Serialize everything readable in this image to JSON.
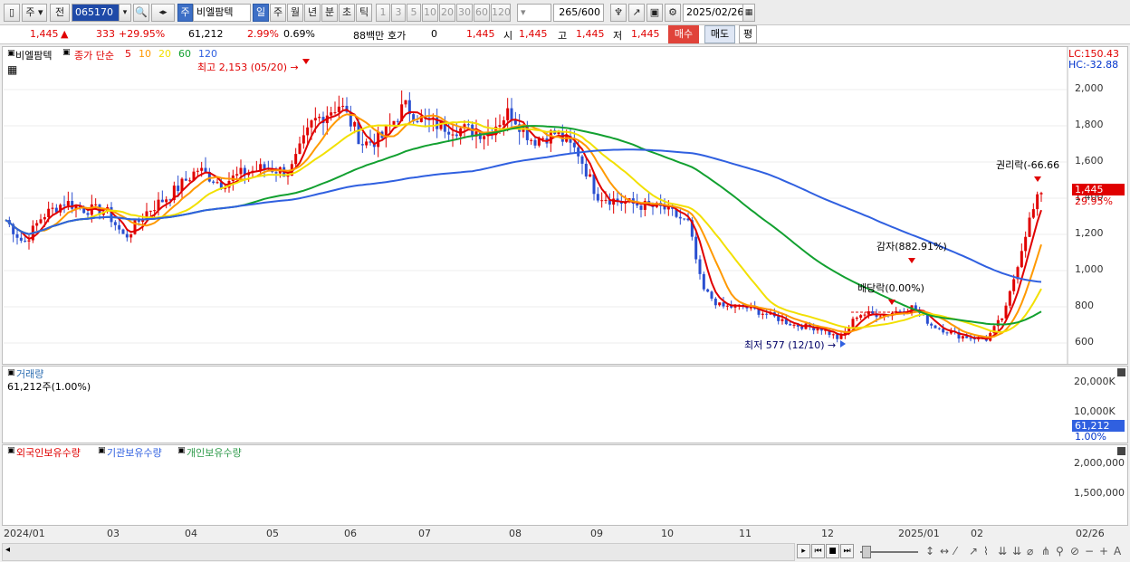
{
  "toolbar": {
    "market": "주",
    "all": "전",
    "code": "065170",
    "stock_name": "비엘팜텍",
    "mode": "주",
    "periods": [
      "일",
      "주",
      "월",
      "년",
      "분",
      "초",
      "틱"
    ],
    "minutes": [
      "1",
      "3",
      "5",
      "10",
      "20",
      "30",
      "60",
      "120"
    ],
    "count": "265",
    "count_total": "/600",
    "date": "2025/02/26"
  },
  "quote": {
    "price": "1,445",
    "change": "333",
    "change_pct": "+29.95%",
    "volume": "61,212",
    "pct1": "2.99%",
    "pct2": "0.69%",
    "amount": "88백만",
    "ask_label": "호가",
    "ask_value": "0",
    "ask_price": "1,445",
    "open_label": "시",
    "open": "1,445",
    "high_label": "고",
    "high": "1,445",
    "low_label": "저",
    "low": "1,445",
    "buy": "매수",
    "sell": "매도",
    "avg": "평"
  },
  "price_panel": {
    "title": "비엘팜텍",
    "legend": "종가 단순",
    "ma": [
      "5",
      "10",
      "20",
      "60",
      "120"
    ],
    "ma_colors": [
      "#e00000",
      "#ff9900",
      "#f2e000",
      "#12a030",
      "#3060e0"
    ],
    "lc": "LC:150.43",
    "hc": "HC:-32.88",
    "yticks": [
      "2,000",
      "1,800",
      "1,600",
      "1,400",
      "1,200",
      "1,000",
      "800",
      "600"
    ],
    "high_note": "최고 2,153 (05/20)",
    "low_note": "최저 577 (12/10)",
    "ann_rights": "권리락(-66.66",
    "ann_reduce": "감자(882.91%)",
    "ann_div": "배당락(0.00%)",
    "last_price": "1,445",
    "last_pct": "29.95%"
  },
  "volume_panel": {
    "title": "거래량",
    "value": "61,212주(1.00%)",
    "yticks": [
      "20,000K",
      "10,000K"
    ],
    "last": "61,212",
    "last_pct": "1.00%"
  },
  "holding_panel": {
    "legend": [
      "외국인보유수량",
      "기관보유수량",
      "개인보유수량"
    ],
    "colors": [
      "#e00000",
      "#3060e0",
      "#2e9a4a"
    ],
    "yticks": [
      "2,000,000",
      "1,500,000"
    ]
  },
  "xaxis": {
    "labels": [
      "2024/01",
      "03",
      "04",
      "05",
      "06",
      "07",
      "08",
      "09",
      "10",
      "11",
      "12",
      "2025/01",
      "02"
    ],
    "end_label": "02/26"
  }
}
